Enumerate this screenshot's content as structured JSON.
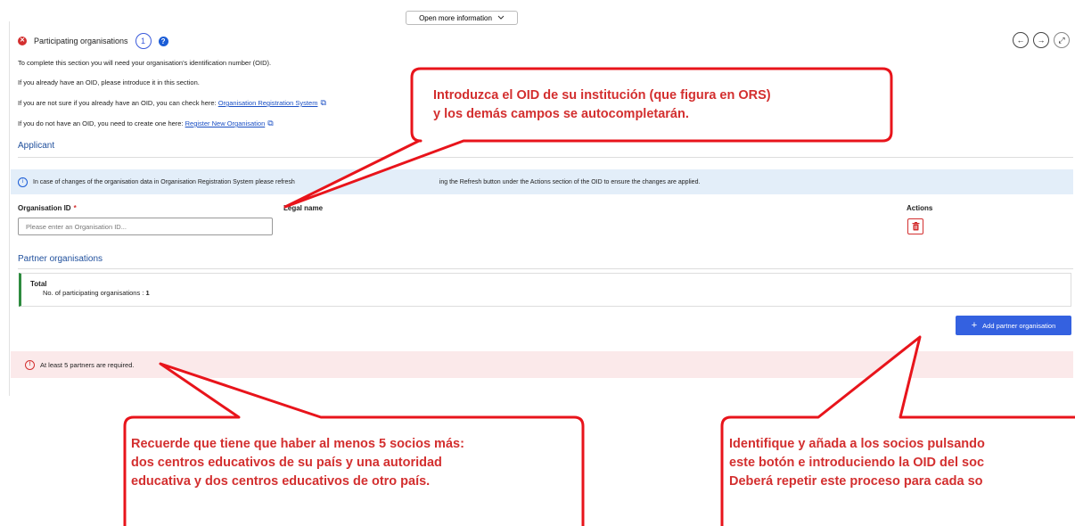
{
  "top": {
    "open_more_label": "Open more information",
    "chevron": "⌵"
  },
  "section": {
    "title": "Participating organisations",
    "count": "1",
    "error_icon": "error-icon",
    "help_icon": "question-icon"
  },
  "nav": {
    "prev": "←",
    "next": "→",
    "expand": "⤢"
  },
  "intro": {
    "line1": "To complete this section you will need your organisation's identification number (OID).",
    "line2": "If you already have an OID, please introduce it in this section.",
    "line3_text": "If you are not sure if you already have an OID, you can check here: ",
    "line3_link": "Organisation Registration System",
    "line4_text": "If you do not have an OID, you need to create one here: ",
    "line4_link": "Register New Organisation",
    "external_icon": "⧉"
  },
  "applicant": {
    "title": "Applicant",
    "info_text": "In case of changes of the organisation data in Organisation Registration System please refresh",
    "info_text_2": "ing the Refresh button under the Actions section of the OID to ensure the changes are applied.",
    "oid_label": "Organisation ID",
    "required_mark": "*",
    "oid_placeholder": "Please enter an Organisation ID...",
    "legal_name_label": "Legal name",
    "actions_label": "Actions"
  },
  "partners": {
    "title": "Partner organisations",
    "total_title": "Total",
    "total_text": "No. of participating organisations : ",
    "total_value": "1",
    "add_label": "Add partner organisation",
    "add_icon": "+",
    "error_text": "At least 5 partners are required."
  },
  "callouts": {
    "c1": "Introduzca el OID de su institución (que figura en ORS)\ny los demás campos se autocompletarán.",
    "c2": "Recuerde que tiene que haber al menos 5 socios más:\ndos centros educativos de su país y una autoridad\neducativa y dos centros educativos de otro país.",
    "c3": "Identifique y añada a los socios pulsando\neste botón e introduciendo la OID del soc\nDeberá repetir este proceso para cada so"
  },
  "colors": {
    "accent": "#3461e0",
    "error": "#d32f2f",
    "callout": "#e8141b",
    "info_bg": "#e3eef9",
    "error_bg": "#fbe9ea"
  }
}
